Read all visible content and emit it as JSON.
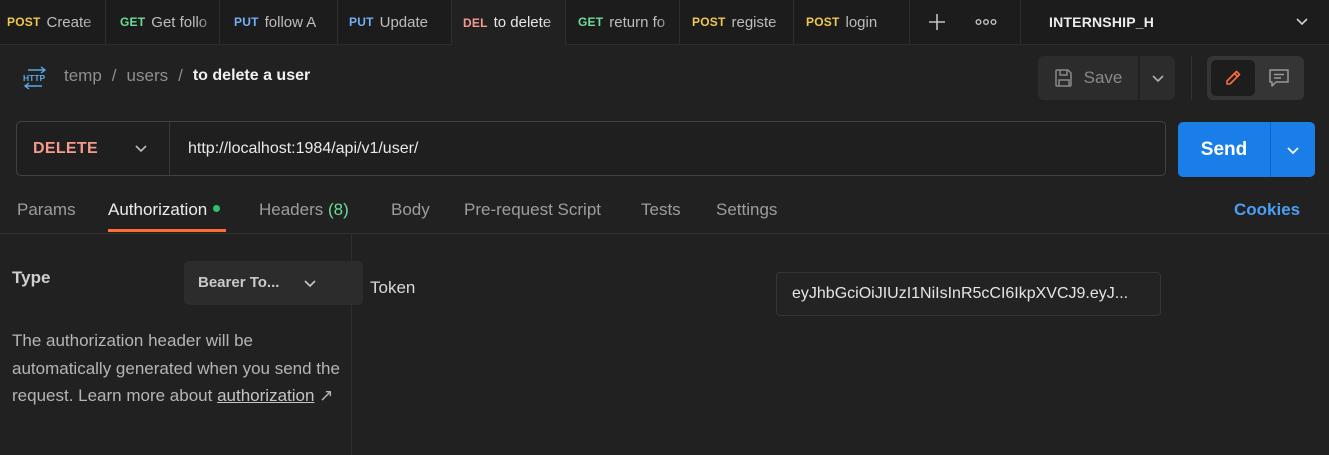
{
  "tabs": [
    {
      "method": "POST",
      "title": "Create"
    },
    {
      "method": "GET",
      "title": "Get follo"
    },
    {
      "method": "PUT",
      "title": "follow A"
    },
    {
      "method": "PUT",
      "title": "Update"
    },
    {
      "method": "DEL",
      "title": "to delete"
    },
    {
      "method": "GET",
      "title": "return fo"
    },
    {
      "method": "POST",
      "title": "registe"
    },
    {
      "method": "POST",
      "title": "login"
    }
  ],
  "workspace": {
    "name": "INTERNSHIP_H"
  },
  "breadcrumb": {
    "icon_text": "HTTP",
    "parts": [
      "temp",
      "users"
    ],
    "separator": "/",
    "current": "to delete a user"
  },
  "toolbar": {
    "save_label": "Save"
  },
  "request": {
    "method": "DELETE",
    "url": "http://localhost:1984/api/v1/user/",
    "send_label": "Send"
  },
  "request_tabs": {
    "params": "Params",
    "authorization": "Authorization",
    "headers": "Headers",
    "headers_count": "(8)",
    "body": "Body",
    "pre_request": "Pre-request Script",
    "tests": "Tests",
    "settings": "Settings",
    "cookies": "Cookies"
  },
  "auth": {
    "type_label": "Type",
    "type_value": "Bearer To...",
    "description": "The authorization header will be automatically generated when you send the request. Learn more about",
    "link_text": "authorization",
    "link_arrow": "↗",
    "token_label": "Token",
    "token_value": "eyJhbGciOiJIUzI1NiIsInR5cCI6IkpXVCJ9.eyJ..."
  },
  "colors": {
    "background": "#212121",
    "method_post": "#f1c84b",
    "method_get": "#6bdd9a",
    "method_put": "#74aef6",
    "method_del": "#f79a8e",
    "send_button": "#1a7ee8",
    "active_tab_underline": "#ff6c37",
    "cookies_link": "#4a9ff5",
    "auth_dot": "#2bc46b"
  }
}
